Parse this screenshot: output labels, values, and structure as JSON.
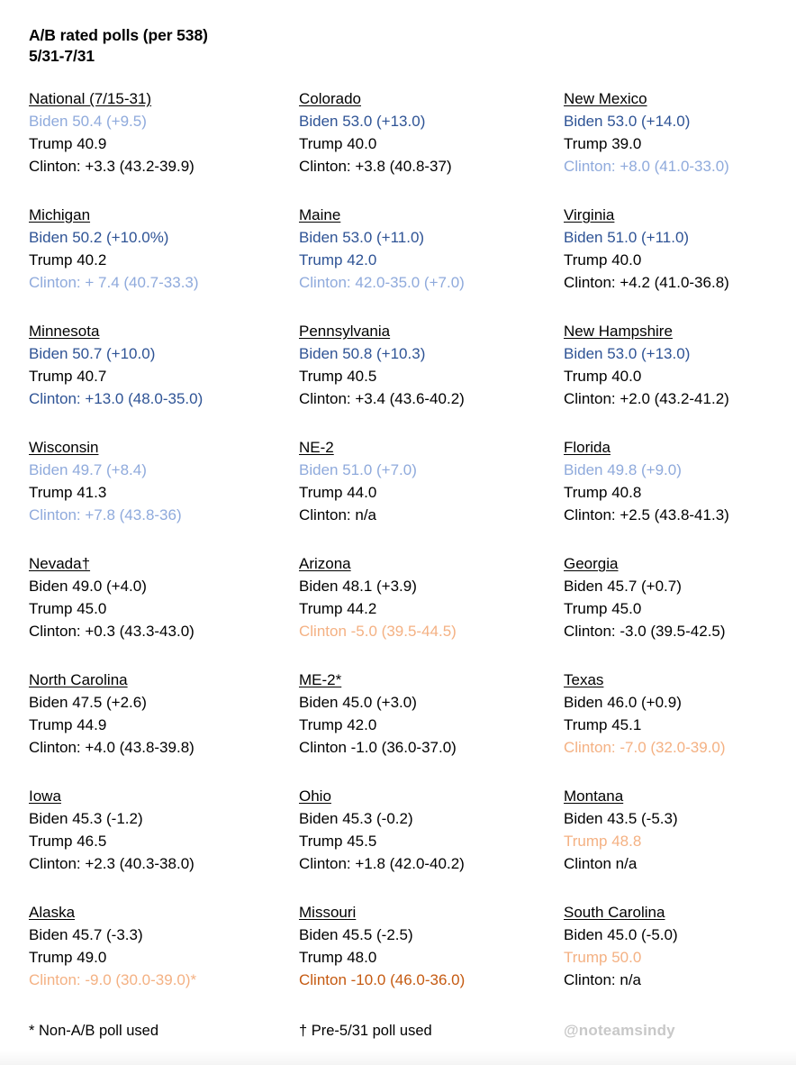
{
  "header": {
    "title_line1": "A/B rated polls (per 538)",
    "title_line2": "5/31-7/31"
  },
  "colors": {
    "black": "#000000",
    "dark_blue": "#2E5395",
    "light_blue": "#8FAADC",
    "light_orange": "#F4B183",
    "dark_orange": "#C55A11",
    "watermark_gray": "#C8C8C8",
    "background": "#FFFFFF"
  },
  "columns": [
    {
      "name": "left-column",
      "entries": [
        {
          "state": "National (7/15-31)",
          "biden": "Biden 50.4 (+9.5)",
          "biden_color": "light_blue",
          "trump": "Trump 40.9",
          "trump_color": "black",
          "clinton": "Clinton: +3.3 (43.2-39.9)",
          "clinton_color": "black"
        },
        {
          "state": "Michigan",
          "biden": "Biden 50.2 (+10.0%)",
          "biden_color": "dark_blue",
          "trump": "Trump 40.2",
          "trump_color": "black",
          "clinton": "Clinton: + 7.4 (40.7-33.3)",
          "clinton_color": "light_blue"
        },
        {
          "state": "Minnesota",
          "biden": "Biden 50.7 (+10.0)",
          "biden_color": "dark_blue",
          "trump": "Trump 40.7",
          "trump_color": "black",
          "clinton": "Clinton: +13.0 (48.0-35.0)",
          "clinton_color": "dark_blue"
        },
        {
          "state": "Wisconsin",
          "biden": "Biden 49.7 (+8.4)",
          "biden_color": "light_blue",
          "trump": "Trump 41.3",
          "trump_color": "black",
          "clinton": "Clinton: +7.8 (43.8-36)",
          "clinton_color": "light_blue"
        },
        {
          "state": "Nevada†",
          "biden": "Biden 49.0 (+4.0)",
          "biden_color": "black",
          "trump": "Trump 45.0",
          "trump_color": "black",
          "clinton": "Clinton: +0.3 (43.3-43.0)",
          "clinton_color": "black"
        },
        {
          "state": "North Carolina",
          "biden": "Biden 47.5 (+2.6)",
          "biden_color": "black",
          "trump": "Trump 44.9",
          "trump_color": "black",
          "clinton": "Clinton: +4.0 (43.8-39.8)",
          "clinton_color": "black"
        },
        {
          "state": "Iowa",
          "biden": "Biden 45.3 (-1.2)",
          "biden_color": "black",
          "trump": "Trump 46.5",
          "trump_color": "black",
          "clinton": "Clinton: +2.3 (40.3-38.0)",
          "clinton_color": "black"
        },
        {
          "state": "Alaska",
          "biden": "Biden 45.7 (-3.3)",
          "biden_color": "black",
          "trump": "Trump 49.0",
          "trump_color": "black",
          "clinton": "Clinton: -9.0 (30.0-39.0)*",
          "clinton_color": "light_orange"
        }
      ]
    },
    {
      "name": "middle-column",
      "entries": [
        {
          "state": "Colorado",
          "biden": "Biden 53.0 (+13.0)",
          "biden_color": "dark_blue",
          "trump": "Trump 40.0",
          "trump_color": "black",
          "clinton": "Clinton: +3.8 (40.8-37)",
          "clinton_color": "black"
        },
        {
          "state": "Maine",
          "biden": "Biden 53.0 (+11.0)",
          "biden_color": "dark_blue",
          "trump": "Trump 42.0",
          "trump_color": "dark_blue",
          "clinton": "Clinton: 42.0-35.0 (+7.0)",
          "clinton_color": "light_blue"
        },
        {
          "state": "Pennsylvania",
          "biden": "Biden 50.8 (+10.3)",
          "biden_color": "dark_blue",
          "trump": "Trump 40.5",
          "trump_color": "black",
          "clinton": "Clinton: +3.4 (43.6-40.2)",
          "clinton_color": "black"
        },
        {
          "state": "NE-2",
          "biden": "Biden 51.0 (+7.0)",
          "biden_color": "light_blue",
          "trump": "Trump 44.0",
          "trump_color": "black",
          "clinton": "Clinton: n/a",
          "clinton_color": "black"
        },
        {
          "state": "Arizona",
          "biden": "Biden 48.1 (+3.9)",
          "biden_color": "black",
          "trump": "Trump 44.2",
          "trump_color": "black",
          "clinton": "Clinton -5.0 (39.5-44.5)",
          "clinton_color": "light_orange"
        },
        {
          "state": "ME-2*",
          "biden": "Biden 45.0 (+3.0)",
          "biden_color": "black",
          "trump": "Trump 42.0",
          "trump_color": "black",
          "clinton": "Clinton -1.0 (36.0-37.0)",
          "clinton_color": "black"
        },
        {
          "state": "Ohio",
          "biden": "Biden 45.3 (-0.2)",
          "biden_color": "black",
          "trump": "Trump 45.5",
          "trump_color": "black",
          "clinton": "Clinton: +1.8 (42.0-40.2)",
          "clinton_color": "black"
        },
        {
          "state": "Missouri",
          "biden": "Biden 45.5 (-2.5)",
          "biden_color": "black",
          "trump": "Trump 48.0",
          "trump_color": "black",
          "clinton": "Clinton -10.0 (46.0-36.0)",
          "clinton_color": "dark_orange"
        }
      ]
    },
    {
      "name": "right-column",
      "entries": [
        {
          "state": "New Mexico",
          "biden": "Biden 53.0 (+14.0)",
          "biden_color": "dark_blue",
          "trump": "Trump 39.0",
          "trump_color": "black",
          "clinton": "Clinton: +8.0 (41.0-33.0)",
          "clinton_color": "light_blue"
        },
        {
          "state": "Virginia",
          "biden": "Biden 51.0 (+11.0)",
          "biden_color": "dark_blue",
          "trump": "Trump 40.0",
          "trump_color": "black",
          "clinton": "Clinton: +4.2 (41.0-36.8)",
          "clinton_color": "black"
        },
        {
          "state": "New Hampshire",
          "biden": "Biden 53.0 (+13.0)",
          "biden_color": "dark_blue",
          "trump": "Trump 40.0",
          "trump_color": "black",
          "clinton": "Clinton: +2.0 (43.2-41.2)",
          "clinton_color": "black"
        },
        {
          "state": "Florida",
          "biden": "Biden 49.8 (+9.0)",
          "biden_color": "light_blue",
          "trump": "Trump 40.8",
          "trump_color": "black",
          "clinton": "Clinton: +2.5 (43.8-41.3)",
          "clinton_color": "black"
        },
        {
          "state": "Georgia",
          "biden": "Biden 45.7 (+0.7)",
          "biden_color": "black",
          "trump": "Trump 45.0",
          "trump_color": "black",
          "clinton": "Clinton: -3.0 (39.5-42.5)",
          "clinton_color": "black"
        },
        {
          "state": "Texas",
          "biden": "Biden 46.0 (+0.9)",
          "biden_color": "black",
          "trump": "Trump 45.1",
          "trump_color": "black",
          "clinton": "Clinton: -7.0 (32.0-39.0)",
          "clinton_color": "light_orange"
        },
        {
          "state": "Montana",
          "biden": "Biden 43.5 (-5.3)",
          "biden_color": "black",
          "trump": "Trump 48.8",
          "trump_color": "light_orange",
          "clinton": "Clinton n/a",
          "clinton_color": "black"
        },
        {
          "state": "South Carolina",
          "biden": "Biden 45.0 (-5.0)",
          "biden_color": "black",
          "trump": "Trump 50.0",
          "trump_color": "light_orange",
          "clinton": "Clinton: n/a",
          "clinton_color": "black"
        }
      ]
    }
  ],
  "footer": {
    "note_star": "* Non-A/B poll used",
    "note_dagger": "† Pre-5/31 poll used",
    "watermark": "@noteamsindy"
  }
}
